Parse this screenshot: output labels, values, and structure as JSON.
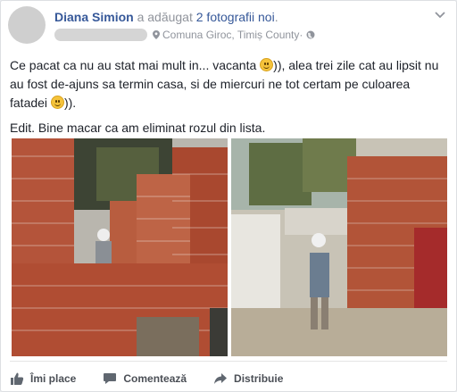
{
  "post": {
    "author": "Diana Simion",
    "action_prefix": " a adăugat ",
    "action_link": "2 fotografii noi",
    "action_suffix": ".",
    "location": "Comuna Giroc, Timiș County",
    "location_sep": " · ",
    "paragraph1_a": "Ce pacat ca nu au stat mai mult in... vacanta ",
    "paragraph1_b": ")), alea trei zile cat au lipsit nu au fost de-ajuns sa termin casa, si de miercuri ne tot certam pe culoarea fatadei ",
    "paragraph1_c": ")).",
    "paragraph2": "Edit. Bine macar ca am eliminat rozul din lista."
  },
  "photos": [
    {
      "name": "photo-child-in-brick-house-room"
    },
    {
      "name": "photo-child-standing-in-yard"
    }
  ],
  "actions": {
    "like": "Îmi place",
    "comment": "Comentează",
    "share": "Distribuie"
  },
  "icons": {
    "emoji": "smiley-emoji",
    "location": "map-pin-icon",
    "privacy": "globe-icon",
    "menu": "chevron-down-icon"
  },
  "colors": {
    "link": "#365899",
    "meta": "#90949c",
    "text": "#1d2129"
  }
}
